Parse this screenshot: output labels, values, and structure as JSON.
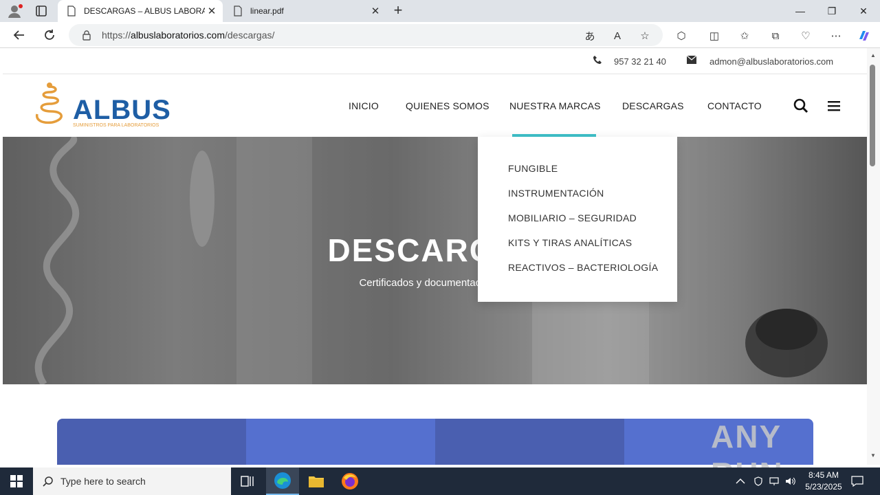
{
  "browser": {
    "tabs": [
      {
        "title": "DESCARGAS – ALBUS LABORATORIOS",
        "active": true
      },
      {
        "title": "linear.pdf",
        "active": false
      }
    ],
    "url_prefix": "https://",
    "url_domain": "albuslaboratorios.com",
    "url_path": "/descargas/",
    "window_controls": {
      "minimize": "—",
      "restore": "❐",
      "close": "✕"
    }
  },
  "site": {
    "contact": {
      "phone": "957 32 21 40",
      "email": "admon@albuslaboratorios.com"
    },
    "logo": {
      "name": "ALBUS",
      "tagline": "SUMINISTROS PARA LABORATORIOS"
    },
    "nav": [
      {
        "label": "INICIO"
      },
      {
        "label": "QUIENES SOMOS"
      },
      {
        "label": "NUESTRA MARCAS"
      },
      {
        "label": "DESCARGAS"
      },
      {
        "label": "CONTACTO"
      }
    ],
    "dropdown": [
      {
        "label": "FUNGIBLE"
      },
      {
        "label": "INSTRUMENTACIÓN"
      },
      {
        "label": "MOBILIARIO – SEGURIDAD"
      },
      {
        "label": "KITS Y TIRAS ANALÍTICAS"
      },
      {
        "label": "REACTIVOS – BACTERIOLOGÍA"
      }
    ],
    "hero": {
      "title": "DESCARGAS",
      "subtitle": "Certificados y documentación útil"
    },
    "accent_color": "#3fc1c9",
    "brand_color": "#1e5ea5"
  },
  "taskbar": {
    "search_placeholder": "Type here to search",
    "time": "8:45 AM",
    "date": "5/23/2025"
  },
  "watermark": "ANY RUN"
}
